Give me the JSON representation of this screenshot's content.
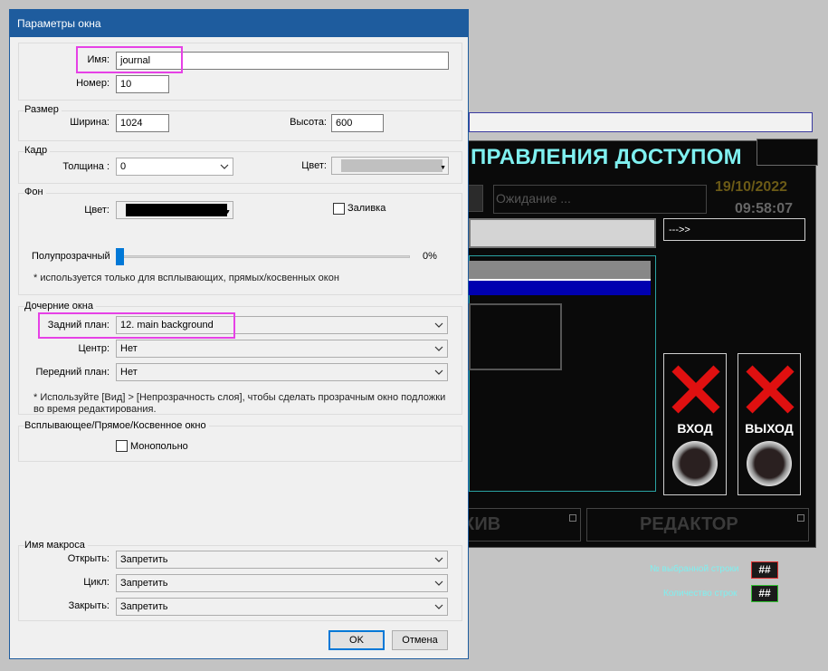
{
  "dialog": {
    "title": "Параметры окна",
    "name_label": "Имя:",
    "name_value": "journal",
    "number_label": "Номер:",
    "number_value": "10",
    "size": {
      "group": "Размер",
      "width_label": "Ширина:",
      "width_value": "1024",
      "height_label": "Высота:",
      "height_value": "600"
    },
    "frame": {
      "group": "Кадр",
      "thickness_label": "Толщина :",
      "thickness_value": "0",
      "color_label": "Цвет:",
      "color_swatch": "#c0c0c0"
    },
    "background": {
      "group": "Фон",
      "color_label": "Цвет:",
      "color_swatch": "#000000",
      "fill_label": "Заливка",
      "fill_checked": false,
      "transparency_label": "Полупрозрачный",
      "transparency_value": "0%",
      "transparency_level": 0,
      "note": "* используется только для всплывающих, прямых/косвенных окон"
    },
    "child": {
      "group": "Дочерние окна",
      "back_label": "Задний план:",
      "back_value": "12. main background",
      "center_label": "Центр:",
      "center_value": "Нет",
      "front_label": "Передний план:",
      "front_value": "Нет",
      "note": "* Используйте [Вид] > [Непрозрачность слоя], чтобы сделать прозрачным окно подложки во время редактирования."
    },
    "popup": {
      "group": "Всплывающее/Прямое/Косвенное окно",
      "modal_label": "Монопольно",
      "modal_checked": false
    },
    "macro": {
      "group": "Имя макроса",
      "open_label": "Открыть:",
      "open_value": "Запретить",
      "cycle_label": "Цикл:",
      "cycle_value": "Запретить",
      "close_label": "Закрыть:",
      "close_value": "Запретить"
    },
    "ok_label": "OK",
    "cancel_label": "Отмена",
    "highlight_color": "#e641e6",
    "title_color": "#1e5c9e"
  },
  "hmi": {
    "title": "ПРАВЛЕНИЯ ДОСТУПОМ",
    "wait": "Ожидание ...",
    "date": "19/10/2022",
    "time": "09:58:07",
    "arrow": "--->>",
    "enter_label": "ВХОД",
    "exit_label": "ВЫХОД",
    "archive_label": "ХИВ",
    "editor_label": "РЕДАКТОР",
    "selected_row_label": "№ выбранной строки",
    "selected_row_value": "##",
    "row_count_label": "Количество строк",
    "row_count_value": "##",
    "title_color": "#7ff0f0"
  }
}
